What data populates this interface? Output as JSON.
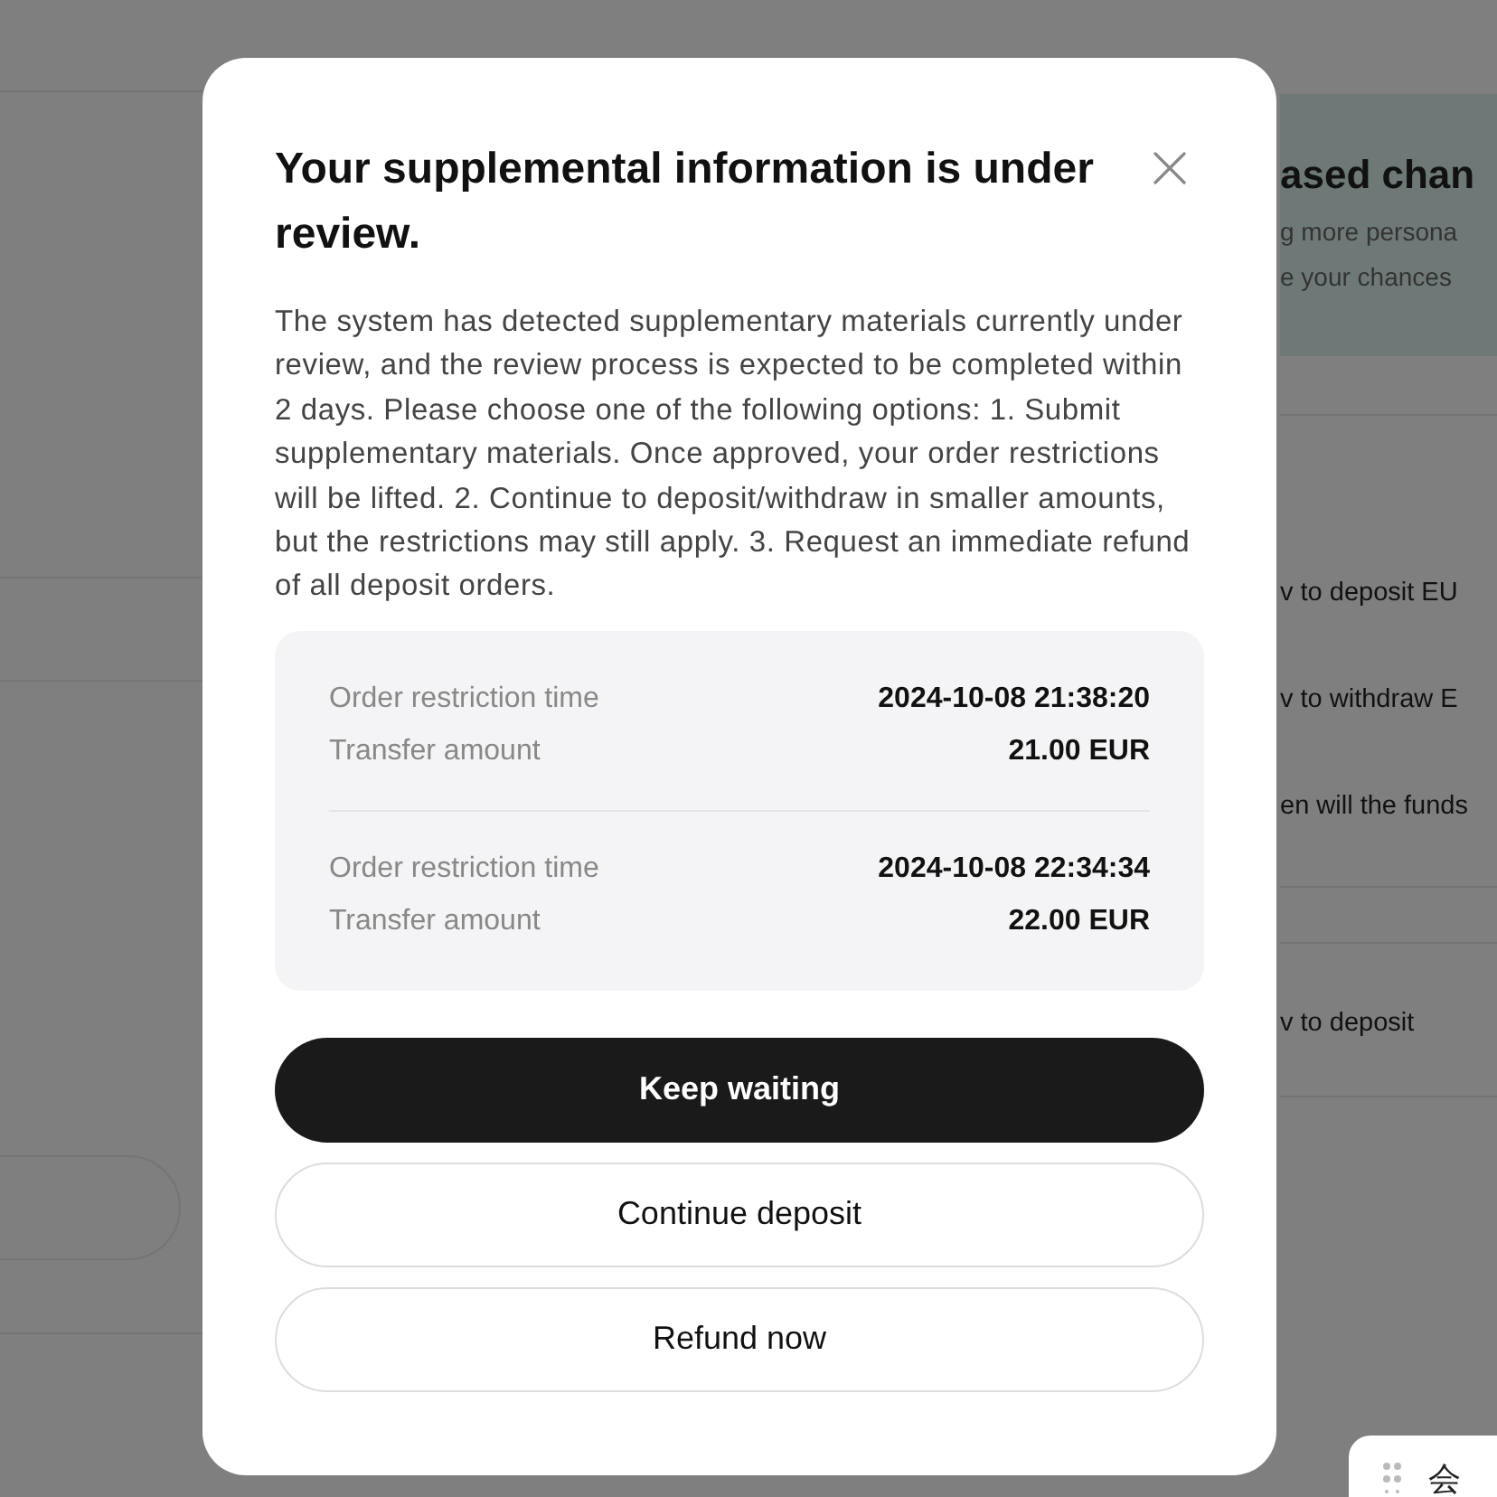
{
  "background": {
    "banner": {
      "title": "ased chan",
      "lines": [
        "g more persona",
        "e your chances"
      ]
    },
    "faq_items": [
      {
        "label": "v to deposit EU"
      },
      {
        "label": "v to withdraw E"
      },
      {
        "label": "en will the funds"
      }
    ],
    "second_item": {
      "label": "v to deposit"
    },
    "chat_widget": {
      "label": "会"
    }
  },
  "modal": {
    "title": "Your supplemental information is under review.",
    "description": "The system has detected supplementary materials currently under review, and the review process is expected to be completed within 2 days. Please choose one of the following options: 1. Submit supplementary materials. Once approved, your order restrictions will be lifted. 2. Continue to deposit/withdraw in smaller amounts, but the restrictions may still apply. 3. Request an immediate refund of all deposit orders.",
    "orders": [
      {
        "rows": [
          {
            "label": "Order restriction time",
            "value": "2024-10-08 21:38:20"
          },
          {
            "label": "Transfer amount",
            "value": "21.00 EUR"
          }
        ]
      },
      {
        "rows": [
          {
            "label": "Order restriction time",
            "value": "2024-10-08 22:34:34"
          },
          {
            "label": "Transfer amount",
            "value": "22.00 EUR"
          }
        ]
      }
    ],
    "buttons": [
      {
        "label": "Keep waiting",
        "kind": "primary"
      },
      {
        "label": "Continue deposit",
        "kind": "secondary"
      },
      {
        "label": "Refund now",
        "kind": "secondary"
      }
    ]
  }
}
